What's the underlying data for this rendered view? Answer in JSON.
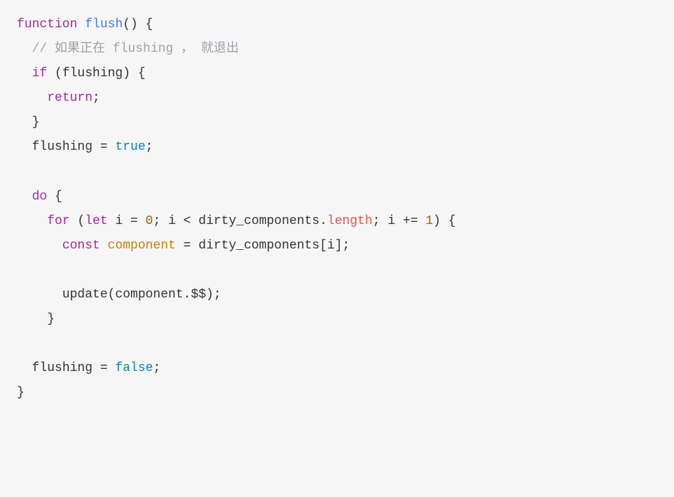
{
  "code": {
    "line1": {
      "kw": "function",
      "name": "flush",
      "after": "() {"
    },
    "line2": {
      "indent": "  ",
      "comment": "// 如果正在 flushing ， 就退出"
    },
    "line3": {
      "indent": "  ",
      "kw": "if",
      "after": " (flushing) {"
    },
    "line4": {
      "indent": "    ",
      "kw": "return",
      "after": ";"
    },
    "line5": {
      "indent": "  ",
      "txt": "}"
    },
    "line6": {
      "indent": "  ",
      "txt1": "flushing = ",
      "bool": "true",
      "txt2": ";"
    },
    "line8": {
      "indent": "  ",
      "kw": "do",
      "after": " {"
    },
    "line9": {
      "indent": "    ",
      "kw1": "for",
      "paren": " (",
      "kw2": "let",
      "txt1": " i = ",
      "num1": "0",
      "txt2": "; i < dirty_components.",
      "prop": "length",
      "txt3": "; i += ",
      "num2": "1",
      "txt4": ") {"
    },
    "line10": {
      "indent": "      ",
      "kw": "const",
      "txt1": " ",
      "var": "component",
      "txt2": " = dirty_components[i];"
    },
    "line12": {
      "indent": "      ",
      "txt": "update(component.$$);"
    },
    "line13": {
      "indent": "    ",
      "txt": "}"
    },
    "line15": {
      "indent": "  ",
      "txt1": "flushing = ",
      "bool": "false",
      "txt2": ";"
    },
    "line16": {
      "txt": "}"
    }
  }
}
